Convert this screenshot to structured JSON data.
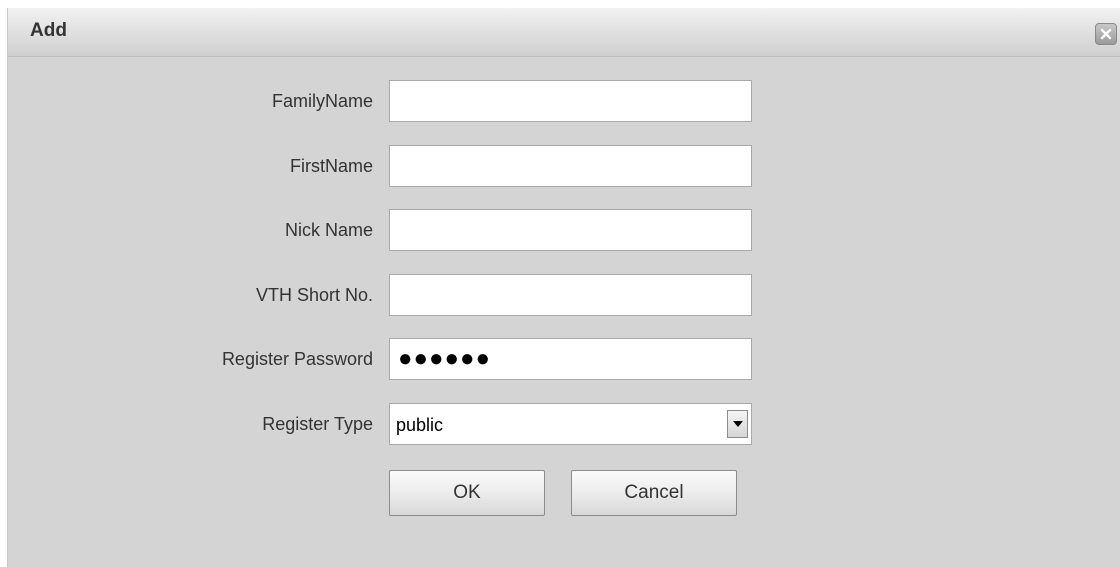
{
  "dialog": {
    "title": "Add",
    "close_icon": "close-icon"
  },
  "form": {
    "family_name": {
      "label": "FamilyName",
      "value": "",
      "placeholder": ""
    },
    "first_name": {
      "label": "FirstName",
      "value": "",
      "placeholder": ""
    },
    "nick_name": {
      "label": "Nick Name",
      "value": "",
      "placeholder": ""
    },
    "vth_short_no": {
      "label": "VTH Short No.",
      "value": "",
      "placeholder": ""
    },
    "register_password": {
      "label": "Register Password",
      "value": "●●●●●●"
    },
    "register_type": {
      "label": "Register Type",
      "selected": "public",
      "arrow_icon": "chevron-down-icon"
    }
  },
  "buttons": {
    "ok_label": "OK",
    "cancel_label": "Cancel"
  },
  "colors": {
    "dialog_background": "#d4d4d4",
    "titlebar_background": "#e2e2e2",
    "field_background": "#ffffff",
    "text": "#333333"
  }
}
